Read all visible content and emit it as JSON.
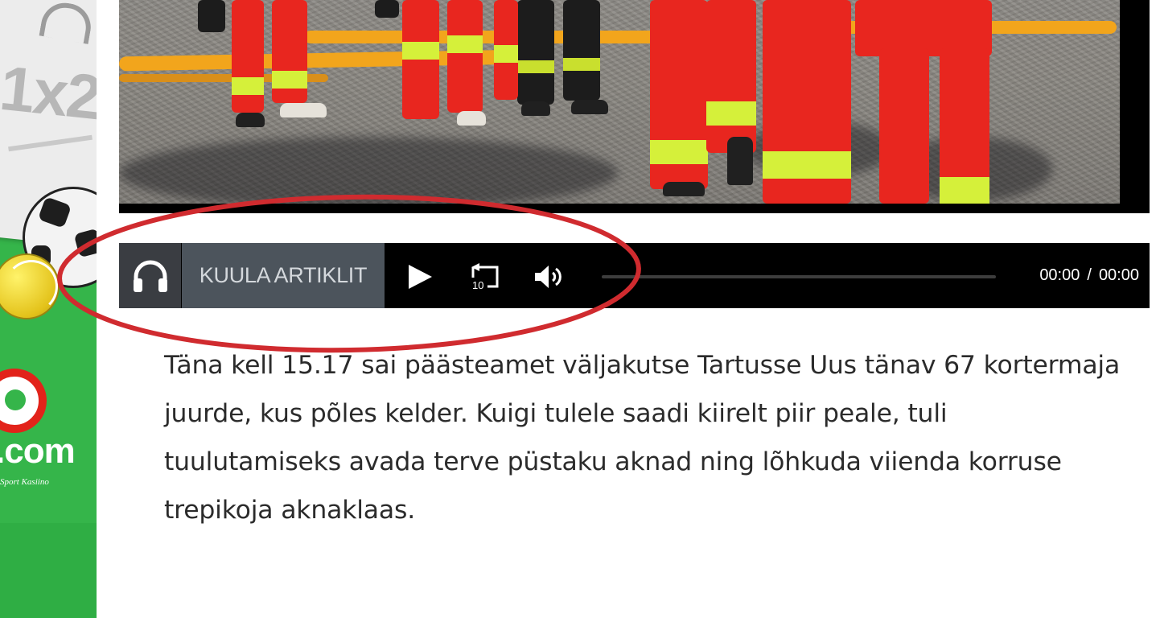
{
  "ad": {
    "brand_suffix": ".com",
    "tagline": "Sport Kasiino",
    "ticket_text": "1x2",
    "colors": {
      "background": "#35b54a",
      "logo_red": "#e2231a"
    }
  },
  "photo": {
    "subject": "rescue-workers-photo"
  },
  "audio_player": {
    "headphones_icon": "headphones-icon",
    "listen_label": "KUULA ARTIKLIT",
    "play_icon": "play-icon",
    "rewind_icon": "rewind-10-icon",
    "rewind_seconds": "10",
    "volume_icon": "volume-icon",
    "current_time": "00:00",
    "separator": "/",
    "duration": "00:00",
    "progress_fraction": 0,
    "colors": {
      "bar": "#000000",
      "listen_bg": "#4c545c"
    }
  },
  "annotation": {
    "color": "#d02b2f"
  },
  "article": {
    "paragraph": "Täna kell 15.17 sai päästeamet väljakutse Tartusse Uus tänav 67 kortermaja juurde, kus põles kelder. Kuigi tulele saadi kiirelt piir peale, tuli tuulutamiseks avada terve püstaku aknad ning lõhkuda viienda korruse trepikoja aknaklaas."
  }
}
